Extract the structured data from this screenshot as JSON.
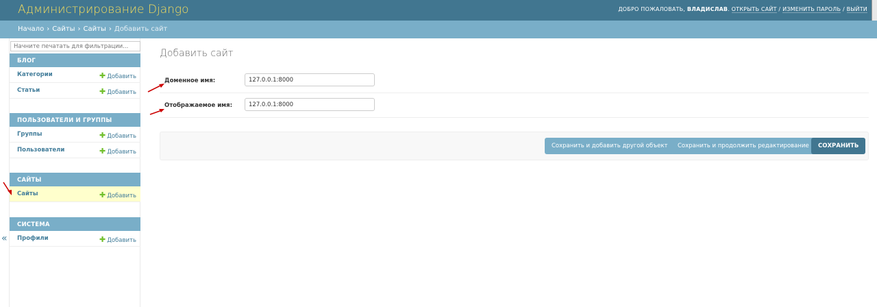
{
  "header": {
    "brand": "Администрирование Django",
    "welcome": "ДОБРО ПОЖАЛОВАТЬ,",
    "username": "ВЛАДИСЛАВ",
    "view_site": "ОТКРЫТЬ САЙТ",
    "change_password": "ИЗМЕНИТЬ ПАРОЛЬ",
    "logout": "ВЫЙТИ",
    "separator": "/"
  },
  "breadcrumbs": {
    "home": "Начало",
    "app": "Сайты",
    "model": "Сайты",
    "current": "Добавить сайт",
    "sep": "›"
  },
  "sidebar": {
    "filter_placeholder": "Начните печатать для фильтрации...",
    "add_label": "Добавить",
    "toggle": "«",
    "modules": [
      {
        "caption": "БЛОГ",
        "rows": [
          "Категории",
          "Статьи"
        ]
      },
      {
        "caption": "ПОЛЬЗОВАТЕЛИ И ГРУППЫ",
        "rows": [
          "Группы",
          "Пользователи"
        ]
      },
      {
        "caption": "САЙТЫ",
        "rows": [
          "Сайты"
        ]
      },
      {
        "caption": "СИСТЕМА",
        "rows": [
          "Профили"
        ]
      }
    ]
  },
  "content": {
    "title": "Добавить сайт",
    "fields": [
      {
        "label": "Доменное имя:",
        "value": "127.0.0.1:8000"
      },
      {
        "label": "Отображаемое имя:",
        "value": "127.0.0.1:8000"
      }
    ],
    "buttons": {
      "save_add_another": "Сохранить и добавить другой объект",
      "save_continue": "Сохранить и продолжить редактирование",
      "save": "СОХРАНИТЬ"
    }
  },
  "colors": {
    "header_bg": "#417690",
    "brand": "#f5dd5d",
    "breadcrumbs_bg": "#79aec8",
    "module_caption_bg": "#79aec8",
    "link": "#447e9b",
    "add_plus": "#70bf2b",
    "selected_row": "#ffffcc",
    "annotation_arrow": "#cc0000"
  },
  "annotations": {
    "arrow_icon": "red-arrow-icon"
  }
}
